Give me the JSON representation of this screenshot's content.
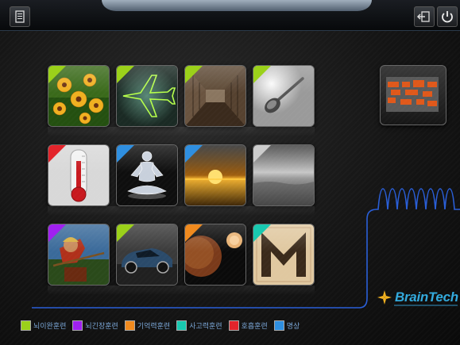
{
  "topbar": {
    "menu_icon": "menu-list-icon",
    "exit_icon": "exit-icon",
    "power_icon": "power-icon"
  },
  "tiles": [
    {
      "name": "flowers",
      "category_color": "#9bd11a"
    },
    {
      "name": "airplane",
      "category_color": "#9bd11a"
    },
    {
      "name": "corridor",
      "category_color": "#9bd11a"
    },
    {
      "name": "spoon",
      "category_color": "#9bd11a"
    },
    {
      "name": "thermometer",
      "category_color": "#e3242b"
    },
    {
      "name": "meditation",
      "category_color": "#2f8fe0"
    },
    {
      "name": "sunset",
      "category_color": "#2f8fe0"
    },
    {
      "name": "seascape",
      "category_color": "#cccccc"
    },
    {
      "name": "archer",
      "category_color": "#a020f0"
    },
    {
      "name": "sports-car",
      "category_color": "#9bd11a"
    },
    {
      "name": "planet",
      "category_color": "#f08a1e"
    },
    {
      "name": "maze",
      "category_color": "#19c9b0"
    }
  ],
  "logo": {
    "text": "BrainTech"
  },
  "legend": [
    {
      "label": "뇌이완훈련",
      "color": "#9bd11a"
    },
    {
      "label": "뇌긴장훈련",
      "color": "#a020f0"
    },
    {
      "label": "기억력훈련",
      "color": "#f08a1e"
    },
    {
      "label": "사고력훈련",
      "color": "#19c9b0"
    },
    {
      "label": "호흡훈련",
      "color": "#e3242b"
    },
    {
      "label": "명상",
      "color": "#2f8fe0"
    }
  ]
}
